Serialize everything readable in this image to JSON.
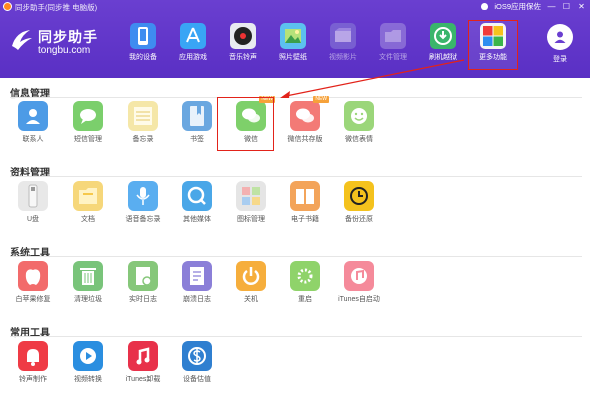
{
  "window": {
    "title": "同步助手(同步推 电脑版)",
    "right_text": "iOS9应用保佐",
    "controls": [
      "—",
      "☐",
      "✕"
    ]
  },
  "brand": {
    "name": "同步助手",
    "url": "tongbu.com"
  },
  "nav": [
    {
      "label": "我的设备",
      "color": "#3f8cf0",
      "icon": "device-icon",
      "dim": false
    },
    {
      "label": "应用游戏",
      "color": "#39a5f5",
      "icon": "app-store-icon",
      "dim": false
    },
    {
      "label": "音乐铃声",
      "color": "#e8ebf0",
      "icon": "music-disc-icon",
      "dim": false
    },
    {
      "label": "照片壁纸",
      "color": "#5cc0ef",
      "icon": "photo-icon",
      "dim": false
    },
    {
      "label": "视频影片",
      "color": "#8b7fd8",
      "icon": "video-icon",
      "dim": true
    },
    {
      "label": "文件管理",
      "color": "#a793e0",
      "icon": "folder-icon",
      "dim": true
    },
    {
      "label": "刷机越狱",
      "color": "#3ab56b",
      "icon": "flash-icon",
      "dim": false
    },
    {
      "label": "更多功能",
      "color": "#f5f5f5",
      "icon": "more-grid-icon",
      "dim": false,
      "active": true
    }
  ],
  "login": {
    "label": "登录"
  },
  "sections": {
    "info": {
      "title": "信息管理",
      "items": [
        {
          "label": "联系人",
          "color": "#4d9be6",
          "icon": "contacts-icon"
        },
        {
          "label": "短信管理",
          "color": "#7bcf6c",
          "icon": "sms-icon"
        },
        {
          "label": "备忘录",
          "color": "#f5e7a8",
          "icon": "notes-icon"
        },
        {
          "label": "书签",
          "color": "#6aa7e0",
          "icon": "bookmark-icon"
        },
        {
          "label": "微信",
          "color": "#7ed06a",
          "icon": "wechat-icon",
          "badge": "NEW"
        },
        {
          "label": "微信共存版",
          "color": "#f37a76",
          "icon": "wechat-dual-icon",
          "badge": "NEW"
        },
        {
          "label": "微信表情",
          "color": "#9bd67a",
          "icon": "wechat-emoji-icon"
        }
      ]
    },
    "data": {
      "title": "资料管理",
      "items": [
        {
          "label": "U盘",
          "color": "#e8e8e8",
          "icon": "usb-drive-icon"
        },
        {
          "label": "文档",
          "color": "#f6d77a",
          "icon": "document-icon"
        },
        {
          "label": "语音备忘录",
          "color": "#5aaef0",
          "icon": "voice-memo-icon"
        },
        {
          "label": "其他媒体",
          "color": "#4aa7e8",
          "icon": "media-icon"
        },
        {
          "label": "图标管理",
          "color": "#e5e5e5",
          "icon": "icon-manage-icon"
        },
        {
          "label": "电子书籍",
          "color": "#f3a45a",
          "icon": "ebook-icon"
        },
        {
          "label": "备份还原",
          "color": "#f4c21d",
          "icon": "backup-restore-icon"
        }
      ]
    },
    "system": {
      "title": "系统工具",
      "items": [
        {
          "label": "白苹果修复",
          "color": "#f26b6b",
          "icon": "white-apple-repair-icon"
        },
        {
          "label": "清理垃圾",
          "color": "#79c47a",
          "icon": "trash-clean-icon"
        },
        {
          "label": "实时日志",
          "color": "#86c77a",
          "icon": "realtime-log-icon"
        },
        {
          "label": "崩溃日志",
          "color": "#8b7fd8",
          "icon": "crash-log-icon"
        },
        {
          "label": "关机",
          "color": "#f6ae3c",
          "icon": "power-icon"
        },
        {
          "label": "重启",
          "color": "#8fd36a",
          "icon": "restart-icon"
        },
        {
          "label": "iTunes自启动",
          "color": "#f58a9a",
          "icon": "itunes-autostart-icon"
        }
      ]
    },
    "common": {
      "title": "常用工具",
      "items": [
        {
          "label": "铃声制作",
          "color": "#ef3b45",
          "icon": "ringtone-icon"
        },
        {
          "label": "视频转换",
          "color": "#2a8ee0",
          "icon": "video-convert-icon"
        },
        {
          "label": "iTunes卸载",
          "color": "#e8314a",
          "icon": "itunes-uninstall-icon"
        },
        {
          "label": "设备估值",
          "color": "#2f7fd0",
          "icon": "device-value-icon"
        }
      ]
    }
  }
}
